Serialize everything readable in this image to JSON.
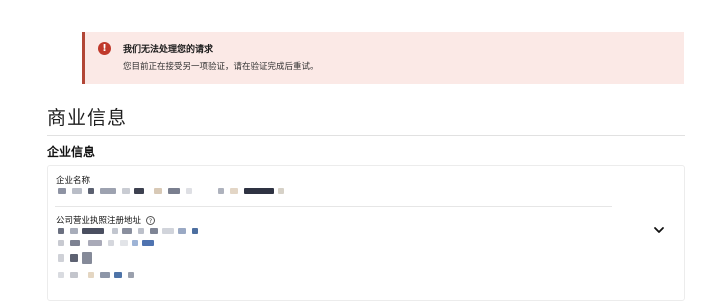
{
  "alert": {
    "icon": "error-exclamation-icon",
    "title": "我们无法处理您的请求",
    "message": "您目前正在接受另一项验证，请在验证完成后重试。",
    "color": "#b24636"
  },
  "page": {
    "section_title": "商业信息",
    "subsection_title": "企业信息"
  },
  "business_info": {
    "company_name_label": "企业名称",
    "registered_address_label": "公司营业执照注册地址",
    "help_icon": "question-circle-icon",
    "expand_icon": "chevron-down-icon"
  }
}
